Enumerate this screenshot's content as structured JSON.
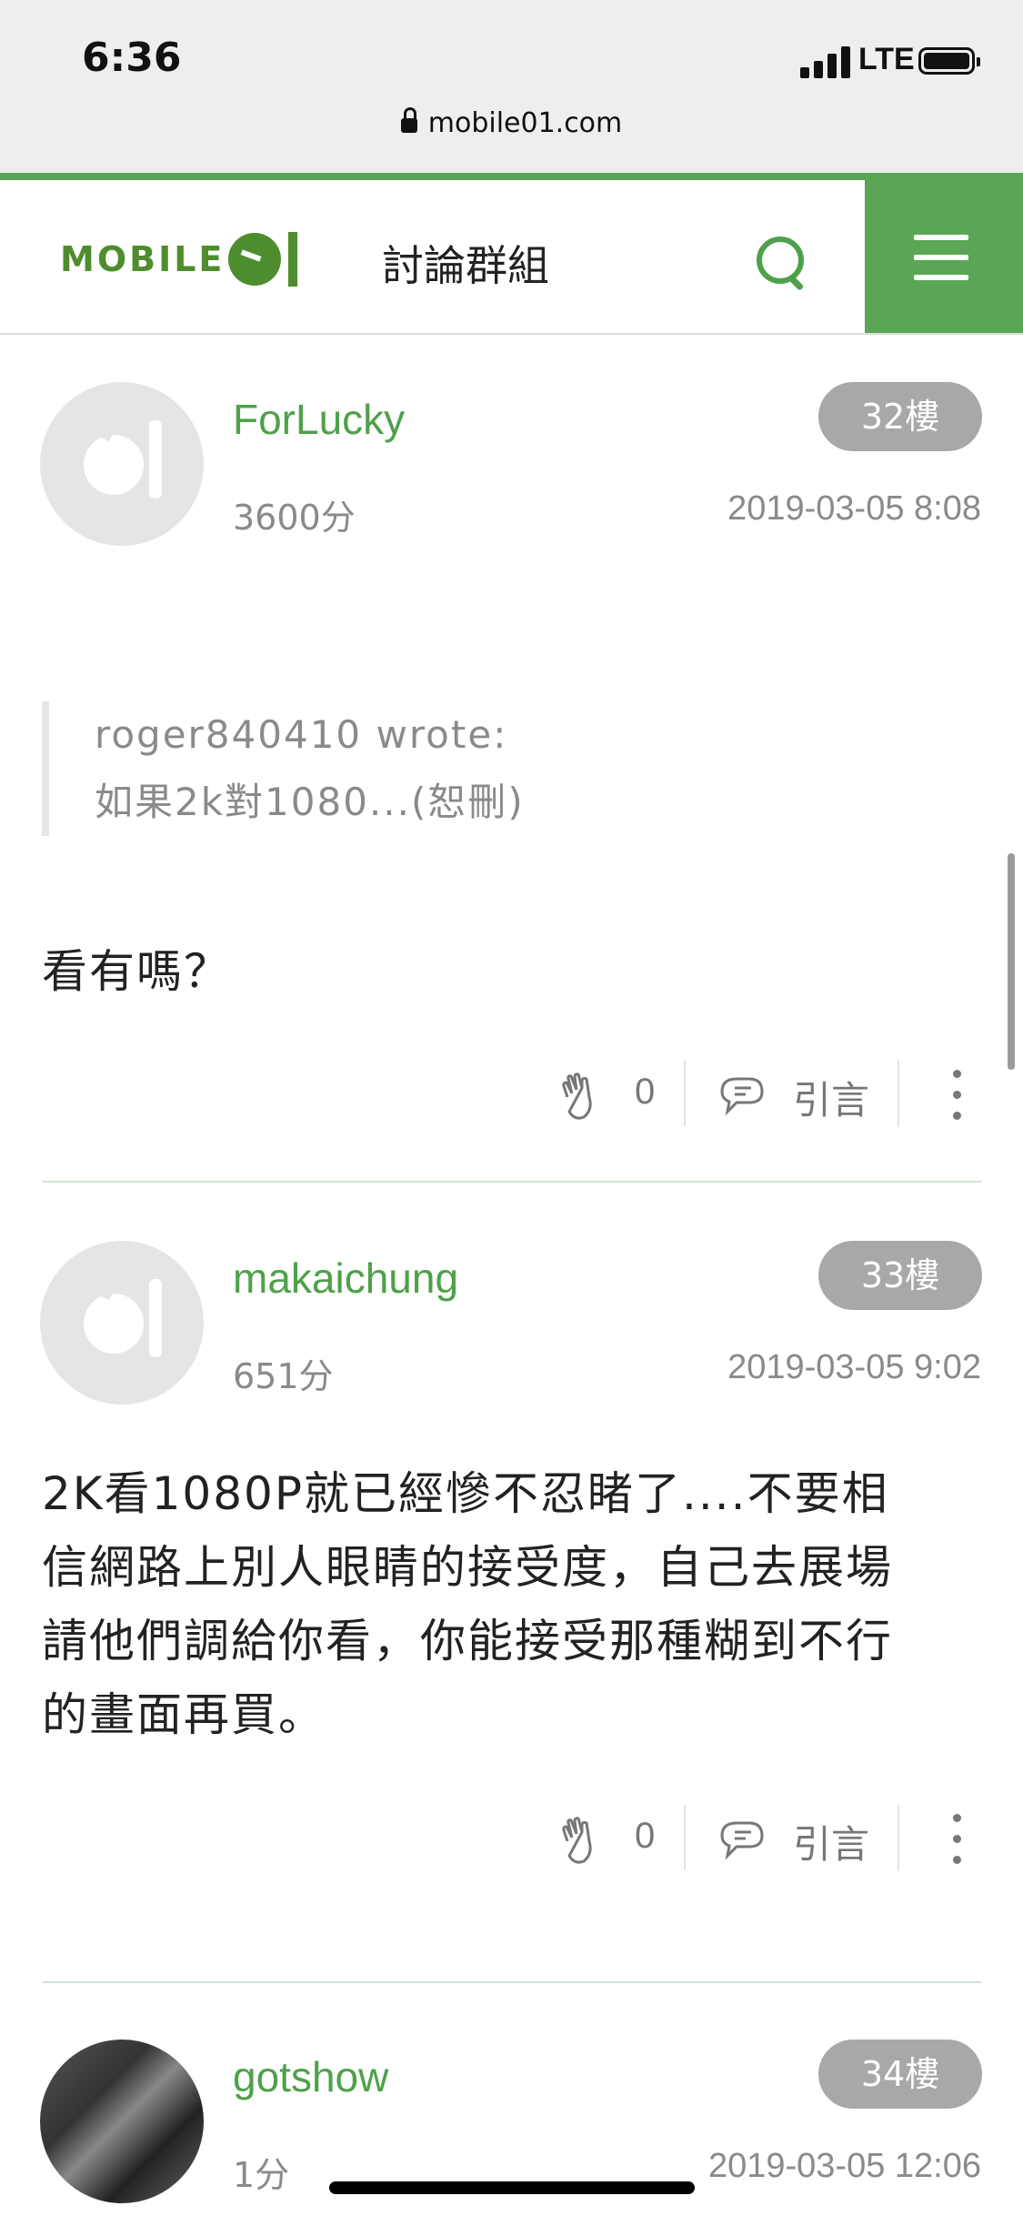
{
  "status_bar": {
    "time": "6:36",
    "network": "LTE"
  },
  "browser": {
    "url": "mobile01.com"
  },
  "header": {
    "logo_text": "MOBILE",
    "section_title": "討論群組"
  },
  "posts": [
    {
      "username": "ForLucky",
      "floor": "32樓",
      "score": "3600分",
      "date": "2019-03-05 8:08",
      "quote_author": "roger840410 wrote:",
      "quote_text": "如果2k對1080...(恕刪)",
      "body": "看有嗎？",
      "likes": "0",
      "quote_label": "引言"
    },
    {
      "username": "makaichung",
      "floor": "33樓",
      "score": "651分",
      "date": "2019-03-05 9:02",
      "body_lines": [
        "2K看1080P就已經慘不忍睹了....不要相",
        "信網路上別人眼睛的接受度，自己去展場",
        "請他們調給你看，你能接受那種糊到不行",
        "的畫面再買。"
      ],
      "likes": "0",
      "quote_label": "引言"
    },
    {
      "username": "gotshow",
      "floor": "34樓",
      "score": "1分",
      "date": "2019-03-05 12:06"
    }
  ],
  "colors": {
    "brand_green": "#5aa654",
    "link_green": "#4ea14a",
    "badge_gray": "#a8a8a8"
  },
  "icons": [
    "lock-icon",
    "search-icon",
    "menu-icon",
    "clap-icon",
    "quote-bubble-icon",
    "more-vertical-icon"
  ]
}
